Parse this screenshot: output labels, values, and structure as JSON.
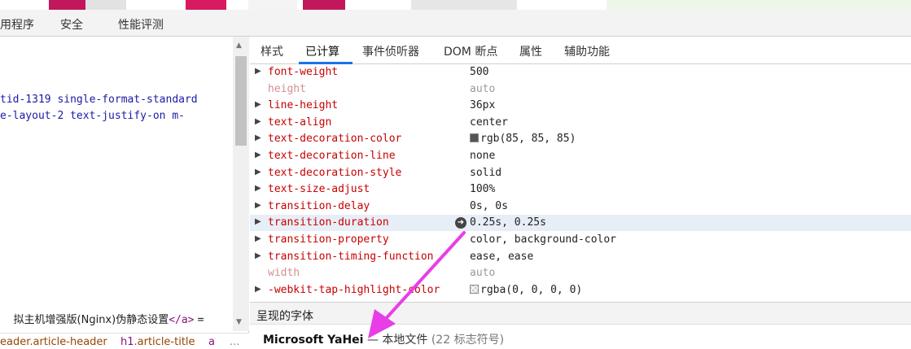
{
  "main_tabs": [
    "用程序",
    "安全",
    "性能评测"
  ],
  "dom": {
    "lines": [
      "tid-1319 single-format-standard",
      "e-layout-2 text-justify-on m-"
    ],
    "selected_text": "拟主机增强版(Nginx)伪静态设置",
    "selected_close": "</a>",
    "selected_eq": "="
  },
  "breadcrumb": {
    "items": [
      {
        "tag": "",
        "cls": "eader.article-header"
      },
      {
        "tag": "h1",
        "cls": ".article-title"
      },
      {
        "tag": "a",
        "cls": ""
      }
    ],
    "more": "..."
  },
  "sub_tabs": [
    "样式",
    "已计算",
    "事件侦听器",
    "DOM 断点",
    "属性",
    "辅助功能"
  ],
  "properties": [
    {
      "name": "font-weight",
      "value": "500",
      "expandable": true
    },
    {
      "name": "height",
      "value": "auto",
      "expandable": false,
      "dim": true
    },
    {
      "name": "line-height",
      "value": "36px",
      "expandable": true
    },
    {
      "name": "text-align",
      "value": "center",
      "expandable": true
    },
    {
      "name": "text-decoration-color",
      "value": "rgb(85, 85, 85)",
      "expandable": true,
      "swatch": "#555555"
    },
    {
      "name": "text-decoration-line",
      "value": "none",
      "expandable": true
    },
    {
      "name": "text-decoration-style",
      "value": "solid",
      "expandable": true
    },
    {
      "name": "text-size-adjust",
      "value": "100%",
      "expandable": true
    },
    {
      "name": "transition-delay",
      "value": "0s, 0s",
      "expandable": true
    },
    {
      "name": "transition-duration",
      "value": "0.25s, 0.25s",
      "expandable": true,
      "highlight": true
    },
    {
      "name": "transition-property",
      "value": "color, background-color",
      "expandable": true
    },
    {
      "name": "transition-timing-function",
      "value": "ease, ease",
      "expandable": true
    },
    {
      "name": "width",
      "value": "auto",
      "expandable": false,
      "dim": true
    },
    {
      "name": "-webkit-tap-highlight-color",
      "value": "rgba(0, 0, 0, 0)",
      "expandable": true,
      "swatch": "transparent"
    }
  ],
  "fonts": {
    "header": "呈现的字体",
    "name": "Microsoft YaHei",
    "separator": "—",
    "source": "本地文件",
    "count": "(22 标志符号)"
  },
  "colors": {
    "accent": "#1a73e8",
    "prop_name": "#c80000",
    "annotation_arrow": "#e83ee8"
  }
}
